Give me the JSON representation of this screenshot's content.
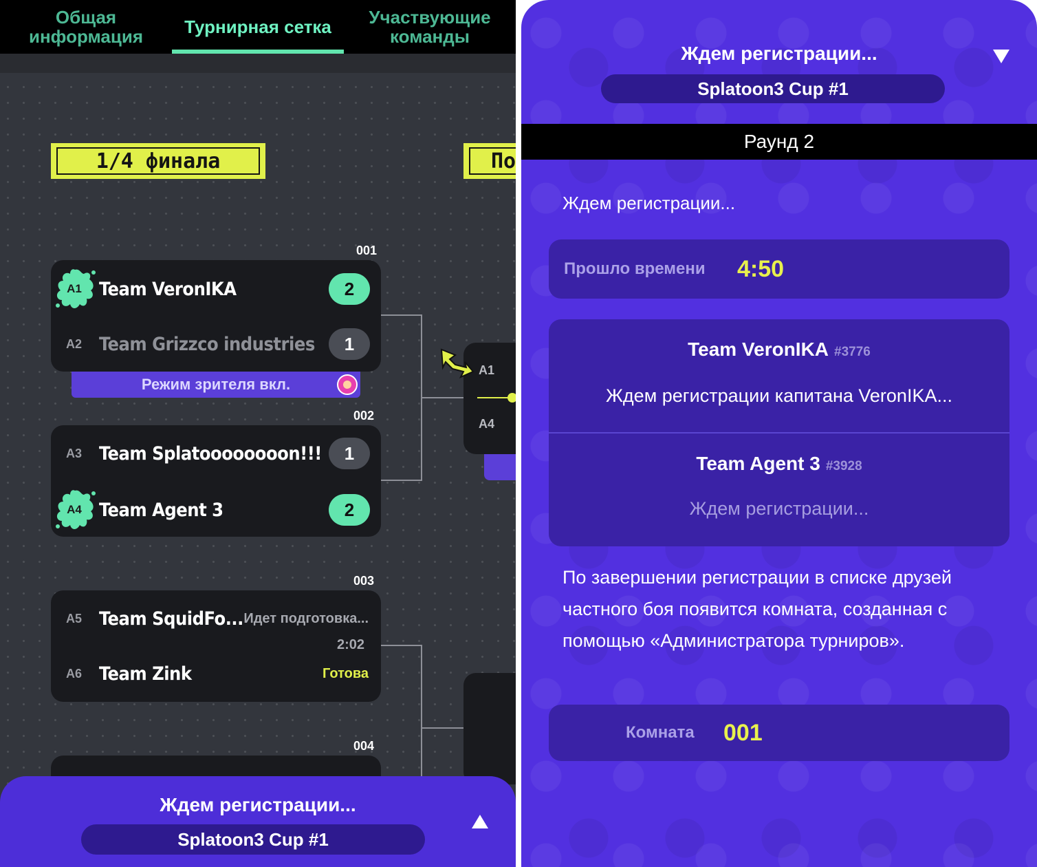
{
  "left": {
    "tabs": [
      {
        "label": "Общая\nинформация"
      },
      {
        "label": "Турнирная сетка"
      },
      {
        "label": "Участвующие\nкоманды"
      }
    ],
    "round_label": "1/4 финала",
    "next_round_label": "По",
    "matches": [
      {
        "number": "001",
        "rows": [
          {
            "seed": "A1",
            "name": "Team VeronIKA",
            "score": "2"
          },
          {
            "seed": "A2",
            "name": "Team Grizzco industries",
            "score": "1"
          }
        ],
        "spectator": "Режим зрителя вкл."
      },
      {
        "number": "002",
        "rows": [
          {
            "seed": "A3",
            "name": "Team Splatoooooooon!!!",
            "score": "1"
          },
          {
            "seed": "A4",
            "name": "Team Agent 3",
            "score": "2"
          }
        ]
      },
      {
        "number": "003",
        "rows": [
          {
            "seed": "A5",
            "name": "Team SquidFo...",
            "status": "Идет подготовка..."
          },
          {
            "seed": "A6",
            "name": "Team Zink",
            "status": "Готова"
          }
        ],
        "timer": "2:02"
      },
      {
        "number": "004"
      }
    ],
    "next_match_seeds": [
      "A1",
      "A4"
    ],
    "sheet": {
      "title": "Ждем регистрации...",
      "cup": "Splatoon3 Cup #1"
    }
  },
  "right": {
    "title": "Ждем регистрации...",
    "cup": "Splatoon3 Cup #1",
    "round": "Раунд 2",
    "status": "Ждем регистрации...",
    "elapsed_label": "Прошло времени",
    "elapsed_value": "4:50",
    "teams": [
      {
        "name": "Team VeronIKA",
        "id": "#3776",
        "message": "Ждем регистрации капитана VeronIKA..."
      },
      {
        "name": "Team Agent 3",
        "id": "#3928",
        "message": "Ждем регистрации..."
      }
    ],
    "info": "По завершении регистрации в списке друзей частного боя появится комната, созданная с помощью «Администратора турниров».",
    "room_label": "Комната",
    "room_value": "001"
  },
  "colors": {
    "accent_green": "#62e5ae",
    "accent_yellow": "#e1f04a",
    "purple": "#5230e0",
    "purple_dark": "#3a22a6",
    "bracket_bg": "#33363d"
  },
  "icons": [
    "splat-seed-icon",
    "pointer-arrow-icon",
    "spectator-avatar-icon",
    "chevron-up-icon",
    "chevron-down-icon"
  ]
}
